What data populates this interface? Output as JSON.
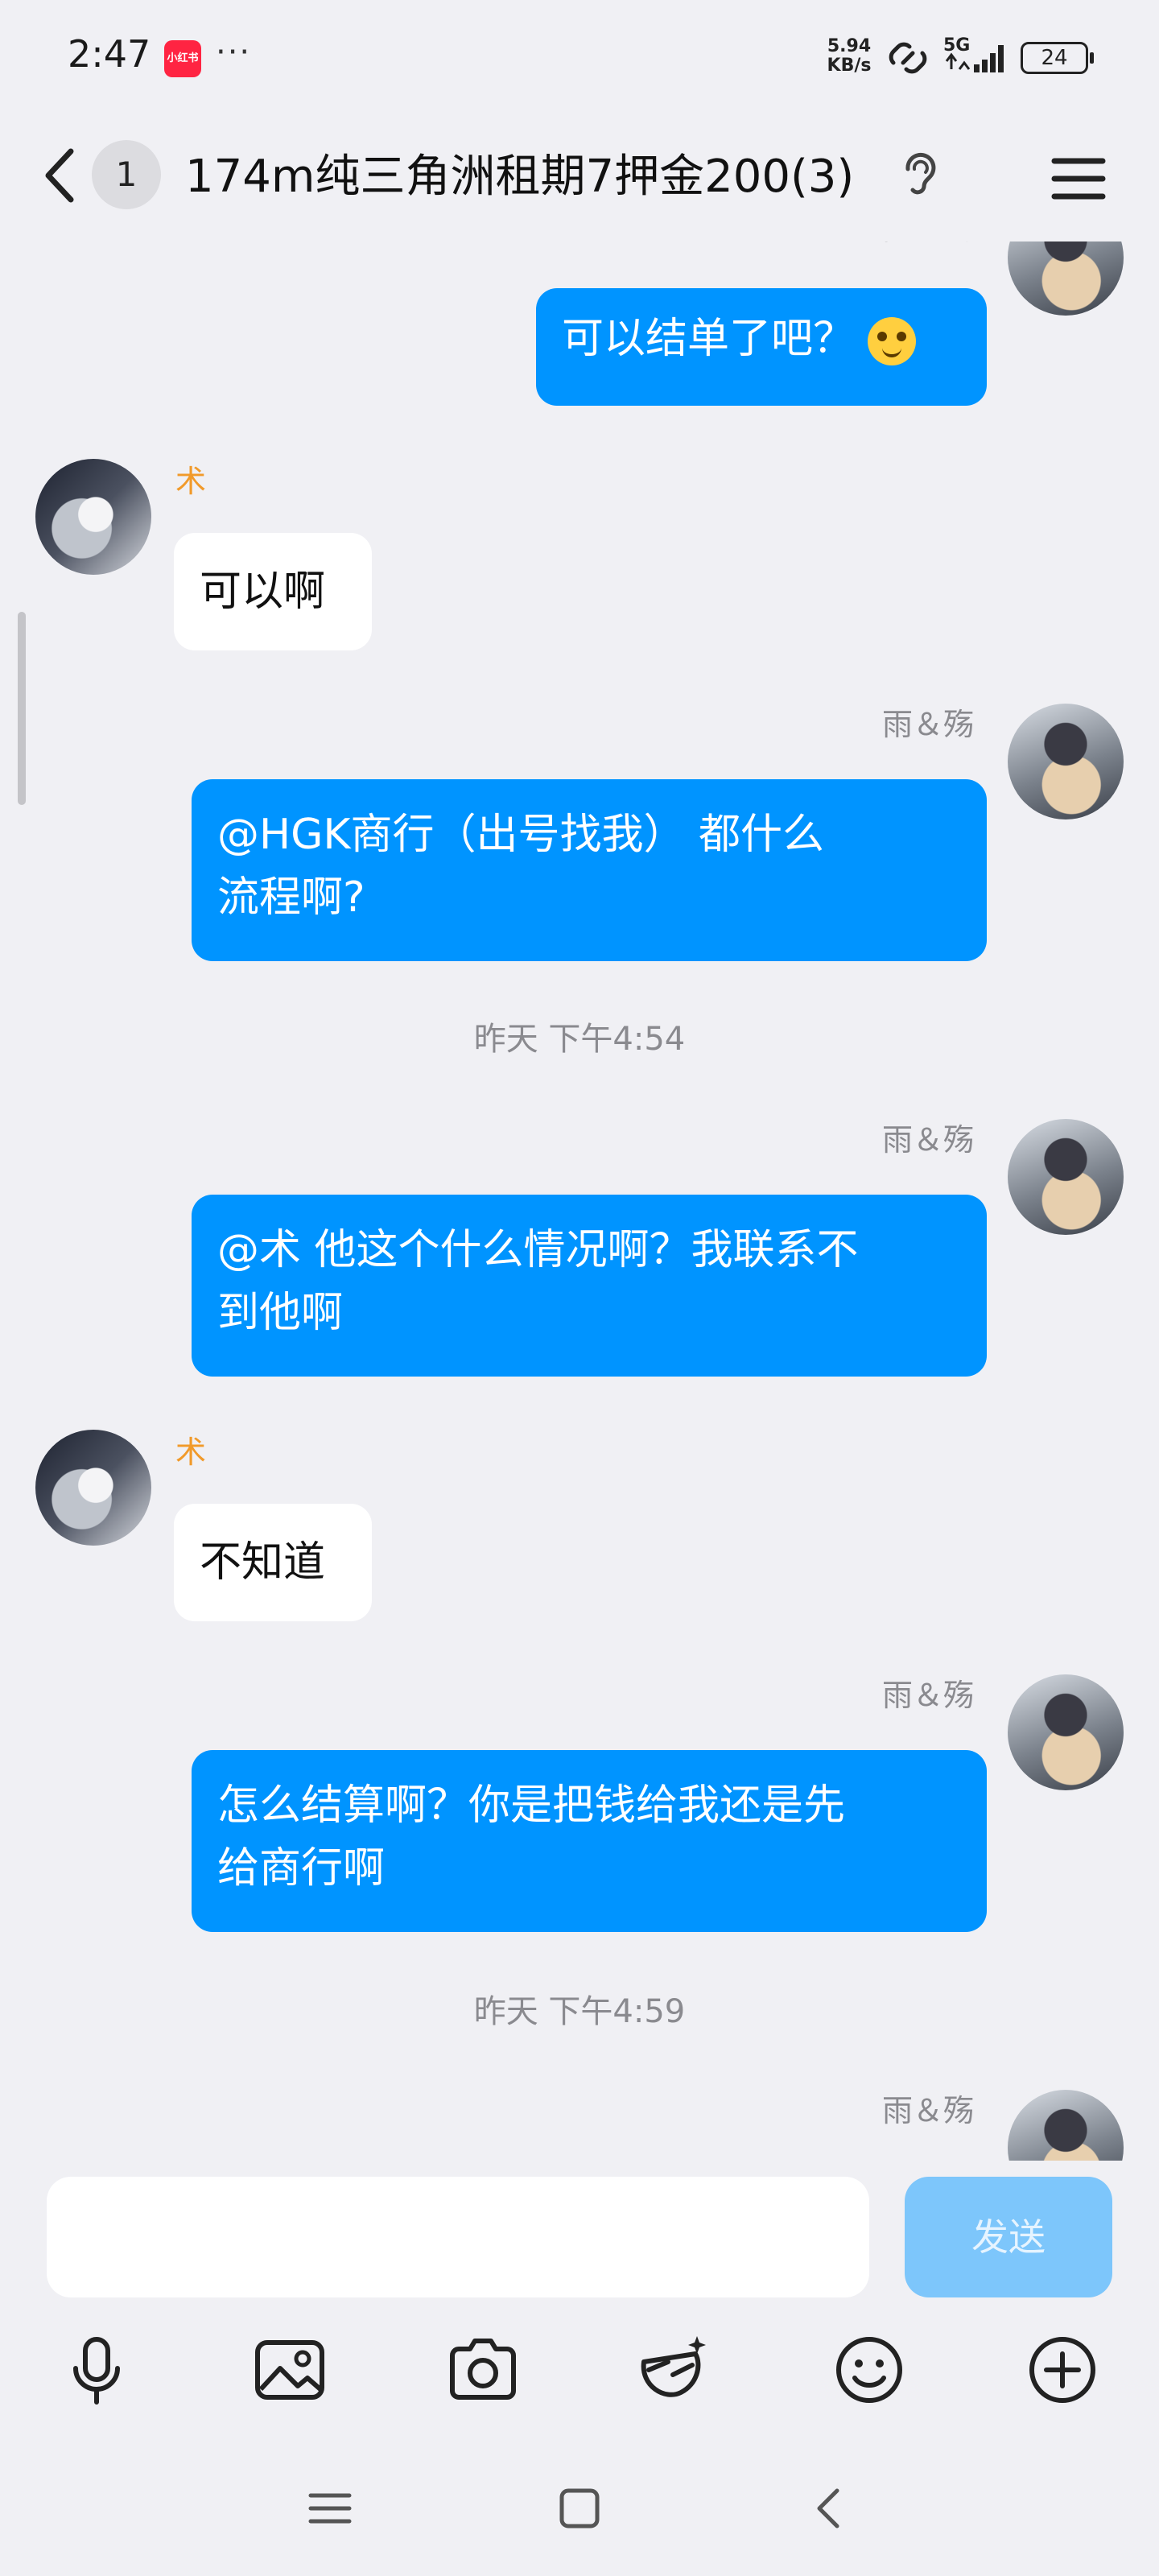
{
  "status_bar": {
    "time": "2:47",
    "app_badge": "小红书",
    "dots": "···",
    "net_speed_value": "5.94",
    "net_speed_unit": "KB/s",
    "network": "5G",
    "battery": "24"
  },
  "header": {
    "unread_count": "1",
    "title": "174m纯三角洲租期7押金200(3)"
  },
  "messages": [
    {
      "sender": "雨＆殇",
      "text": "可以结单了吧？"
    },
    {
      "sender": "术",
      "text": "可以啊"
    },
    {
      "sender": "雨＆殇",
      "line1": "@HGK商行（出号找我） 都什么",
      "line2": "流程啊?"
    },
    {
      "time": "昨天 下午4:54"
    },
    {
      "sender": "雨＆殇",
      "line1": "@术 他这个什么情况啊？我联系不",
      "line2": "到他啊"
    },
    {
      "sender": "术",
      "text": "不知道"
    },
    {
      "sender": "雨＆殇",
      "line1": "怎么结算啊？你是把钱给我还是先",
      "line2": "给商行啊"
    },
    {
      "time": "昨天 下午4:59"
    },
    {
      "sender": "雨＆殇"
    }
  ],
  "input": {
    "placeholder": "",
    "send_label": "发送"
  },
  "toolbar": [
    "microphone-icon",
    "image-icon",
    "camera-icon",
    "game-icon",
    "emoji-icon",
    "plus-icon"
  ],
  "colors": {
    "self_bubble": "#0094ff",
    "other_bubble": "#ffffff",
    "other_name": "#f19a2a",
    "send_button_disabled": "#7dc6fb",
    "background": "#f0f0f4"
  }
}
